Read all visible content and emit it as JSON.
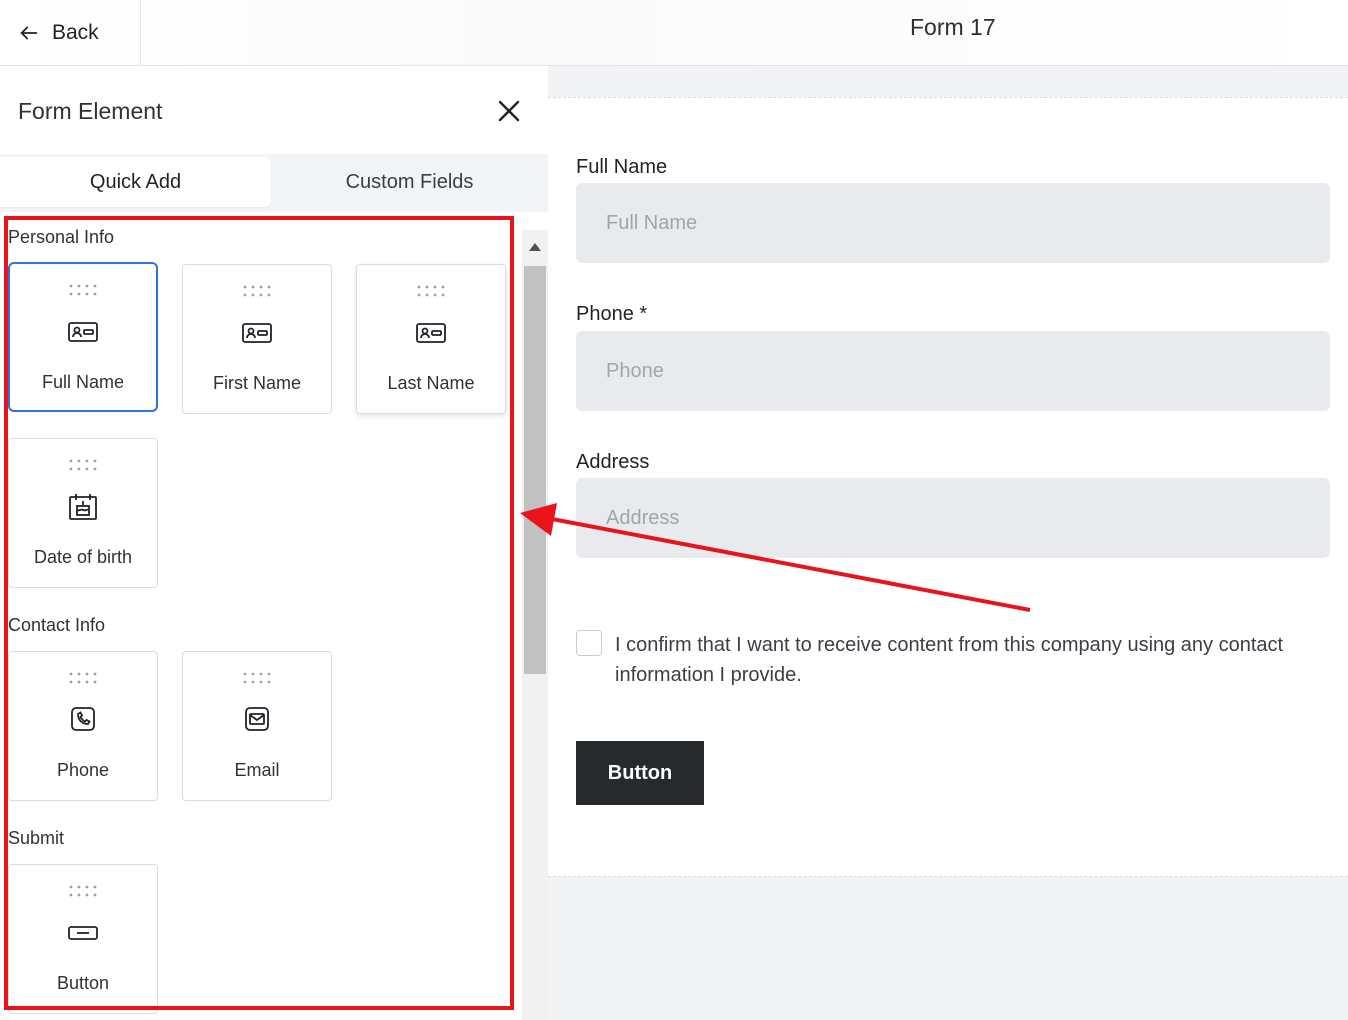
{
  "header": {
    "back_label": "Back",
    "form_title": "Form 17"
  },
  "panel": {
    "title": "Form Element",
    "tabs": [
      {
        "label": "Quick Add",
        "active": true
      },
      {
        "label": "Custom Fields",
        "active": false
      }
    ],
    "sections": [
      {
        "title": "Personal Info",
        "items": [
          {
            "label": "Full Name",
            "icon": "id-card-icon",
            "selected": true
          },
          {
            "label": "First Name",
            "icon": "id-card-icon"
          },
          {
            "label": "Last Name",
            "icon": "id-card-icon"
          },
          {
            "label": "Date of birth",
            "icon": "birthday-cake-icon"
          }
        ]
      },
      {
        "title": "Contact Info",
        "items": [
          {
            "label": "Phone",
            "icon": "phone-icon"
          },
          {
            "label": "Email",
            "icon": "mail-icon"
          }
        ]
      },
      {
        "title": "Submit",
        "items": [
          {
            "label": "Button",
            "icon": "button-icon"
          }
        ]
      }
    ]
  },
  "form": {
    "fields": [
      {
        "label": "Full Name",
        "placeholder": "Full Name"
      },
      {
        "label": "Phone *",
        "placeholder": "Phone"
      },
      {
        "label": "Address",
        "placeholder": "Address"
      }
    ],
    "consent_text": "I confirm that I want to receive content from this company using any contact information I provide.",
    "button_label": "Button"
  },
  "colors": {
    "highlight": "#e8131b",
    "selected_border": "#2f6fe0",
    "button_bg": "#262a2d"
  }
}
